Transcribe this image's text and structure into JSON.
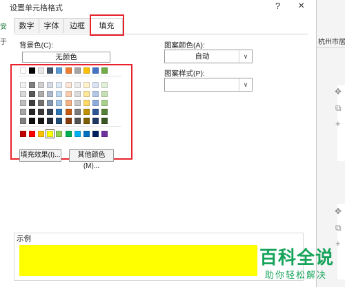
{
  "dialog": {
    "title": "设置单元格格式",
    "help": "?",
    "close": "×"
  },
  "tabs": [
    "数字",
    "字体",
    "边框",
    "填充"
  ],
  "active_tab": "填充",
  "background": {
    "label": "背景色(C):",
    "no_color": "无颜色",
    "theme_top_row": [
      "#ffffff",
      "#000000",
      "#e7e6e6",
      "#44546a",
      "#5b9bd5",
      "#ed7d31",
      "#a5a5a5",
      "#ffc000",
      "#4472c4",
      "#70ad47"
    ],
    "theme_shades": [
      [
        "#f2f2f2",
        "#7f7f7f",
        "#d0cece",
        "#d6dce5",
        "#deebf7",
        "#fbe5d6",
        "#ededed",
        "#fff2cc",
        "#dae3f3",
        "#e2f0d9"
      ],
      [
        "#d9d9d9",
        "#595959",
        "#aeabab",
        "#adb9ca",
        "#bdd7ee",
        "#f8cbad",
        "#dbdbdb",
        "#ffe699",
        "#b4c7e7",
        "#c5e0b4"
      ],
      [
        "#bfbfbf",
        "#404040",
        "#757171",
        "#8497b0",
        "#9dc3e6",
        "#f4b183",
        "#c9c9c9",
        "#ffd966",
        "#8faadc",
        "#a9d18e"
      ],
      [
        "#a6a6a6",
        "#262626",
        "#3a3838",
        "#333f50",
        "#2e75b6",
        "#c55a11",
        "#7b7b7b",
        "#bf9000",
        "#2f5597",
        "#538135"
      ],
      [
        "#808080",
        "#0d0d0d",
        "#171616",
        "#222a35",
        "#1f4e79",
        "#843c0c",
        "#525252",
        "#7f6000",
        "#203864",
        "#385723"
      ]
    ],
    "standard": [
      "#c00000",
      "#ff0000",
      "#ffc000",
      "#ffff00",
      "#92d050",
      "#00b050",
      "#00b0f0",
      "#0070c0",
      "#002060",
      "#7030a0"
    ],
    "fill_effects_button": "填充效果(I)...",
    "more_colors_button": "其他颜色(M)..."
  },
  "pattern": {
    "color_label": "图案颜色(A):",
    "color_value": "自动",
    "style_label": "图案样式(P):",
    "style_value": ""
  },
  "sample": {
    "label": "示例",
    "color": "#ffff00"
  },
  "background_text": {
    "left_letter_1": "安",
    "left_letter_2": "于",
    "right_header": "杭州市居住"
  },
  "watermark": {
    "line1": "百科全说",
    "line2": "助你轻松解决"
  },
  "colors": {
    "highlight_red": "#e8212b",
    "watermark_green": "#16a35a"
  }
}
